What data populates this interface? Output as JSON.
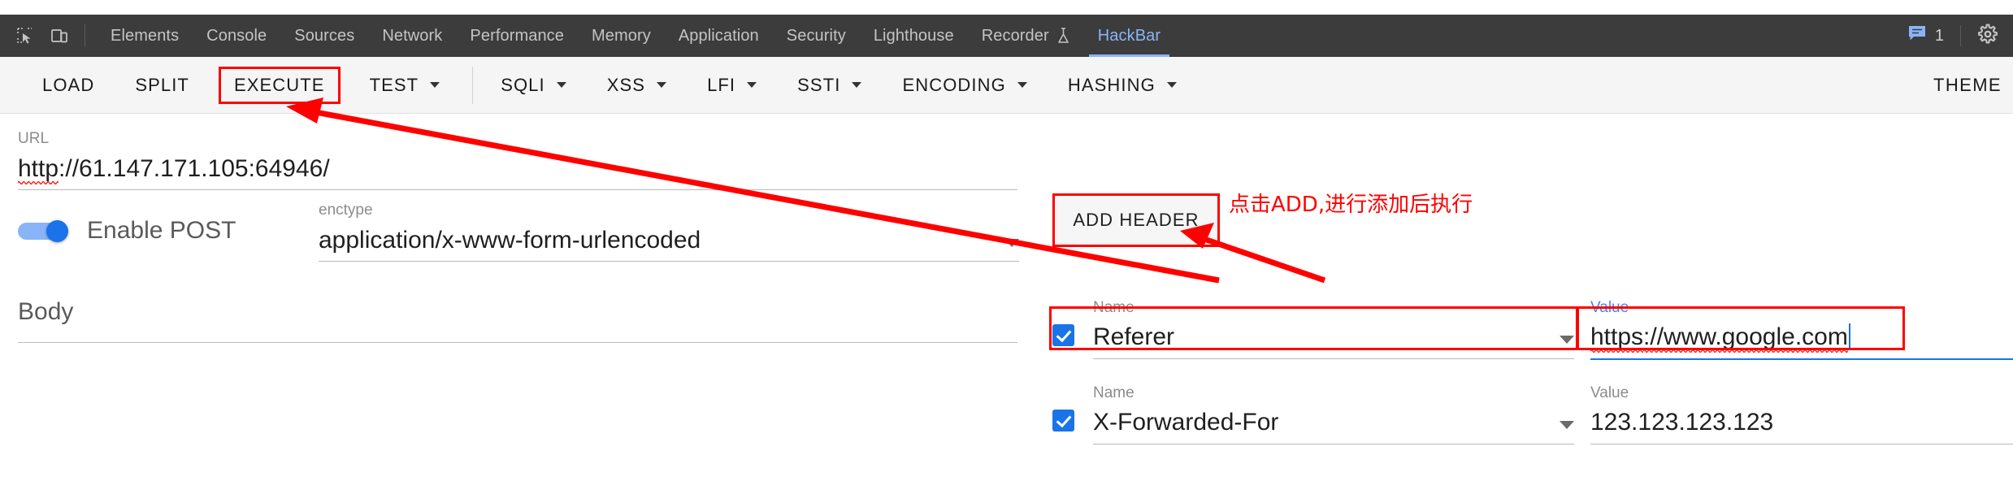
{
  "devtools": {
    "icons": [
      {
        "name": "inspect-element-icon"
      },
      {
        "name": "device-toolbar-icon"
      }
    ],
    "tabs": [
      {
        "label": "Elements",
        "active": false
      },
      {
        "label": "Console",
        "active": false
      },
      {
        "label": "Sources",
        "active": false
      },
      {
        "label": "Network",
        "active": false
      },
      {
        "label": "Performance",
        "active": false
      },
      {
        "label": "Memory",
        "active": false
      },
      {
        "label": "Application",
        "active": false
      },
      {
        "label": "Security",
        "active": false
      },
      {
        "label": "Lighthouse",
        "active": false
      },
      {
        "label": "Recorder",
        "active": false,
        "icon": "flask-icon"
      },
      {
        "label": "HackBar",
        "active": true
      }
    ],
    "message_count": "1",
    "message_icon": "message-icon",
    "settings_icon": "gear-icon",
    "bar_bg": "#3c3c3c",
    "active_color": "#8ab4f8"
  },
  "toolbar": {
    "buttons": [
      {
        "label": "LOAD",
        "dropdown": false,
        "highlighted": false
      },
      {
        "label": "SPLIT",
        "dropdown": false,
        "highlighted": false
      },
      {
        "label": "EXECUTE",
        "dropdown": false,
        "highlighted": true
      },
      {
        "label": "TEST",
        "dropdown": true,
        "highlighted": false
      }
    ],
    "buttons2": [
      {
        "label": "SQLI",
        "dropdown": true
      },
      {
        "label": "XSS",
        "dropdown": true
      },
      {
        "label": "LFI",
        "dropdown": true
      },
      {
        "label": "SSTI",
        "dropdown": true
      },
      {
        "label": "ENCODING",
        "dropdown": true
      },
      {
        "label": "HASHING",
        "dropdown": true
      }
    ],
    "theme_label": "THEME",
    "highlight_color": "#ff0000"
  },
  "form": {
    "url": {
      "label": "URL",
      "value_prefix": "http",
      "value_rest": "://61.147.171.105:64946/",
      "misspelled": true
    },
    "post_toggle": {
      "label": "Enable POST",
      "enabled": true
    },
    "enctype": {
      "label": "enctype",
      "value": "application/x-www-form-urlencoded",
      "caret_icon": "chevron-down-icon"
    },
    "body": {
      "label": "Body",
      "value": ""
    },
    "add_header_button": {
      "label": "ADD HEADER",
      "highlighted": true
    },
    "headers": [
      {
        "checked": true,
        "name_label": "Name",
        "name_value": "Referer",
        "name_caret_icon": "chevron-down-icon",
        "value_label": "Value",
        "value_prefix": "https",
        "value_rest": "://www.google.com",
        "value_focused": true,
        "name_label_focused": false,
        "value_label_focused": true,
        "highlighted": true,
        "cursor": true
      },
      {
        "checked": true,
        "name_label": "Name",
        "name_value": "X-Forwarded-For",
        "name_caret_icon": "chevron-down-icon",
        "value_label": "Value",
        "value_prefix": "123.123.123.123",
        "value_rest": "",
        "value_focused": false,
        "name_label_focused": false,
        "value_label_focused": false,
        "highlighted": false,
        "cursor": false
      }
    ]
  },
  "annotations": {
    "note_cn": "点击ADD,进行添加后执行",
    "color": "#ff0000",
    "arrow_from_execute": "arrow-pointing-to-execute-button",
    "arrow_to_referer": "arrow-pointing-to-referer-row"
  }
}
